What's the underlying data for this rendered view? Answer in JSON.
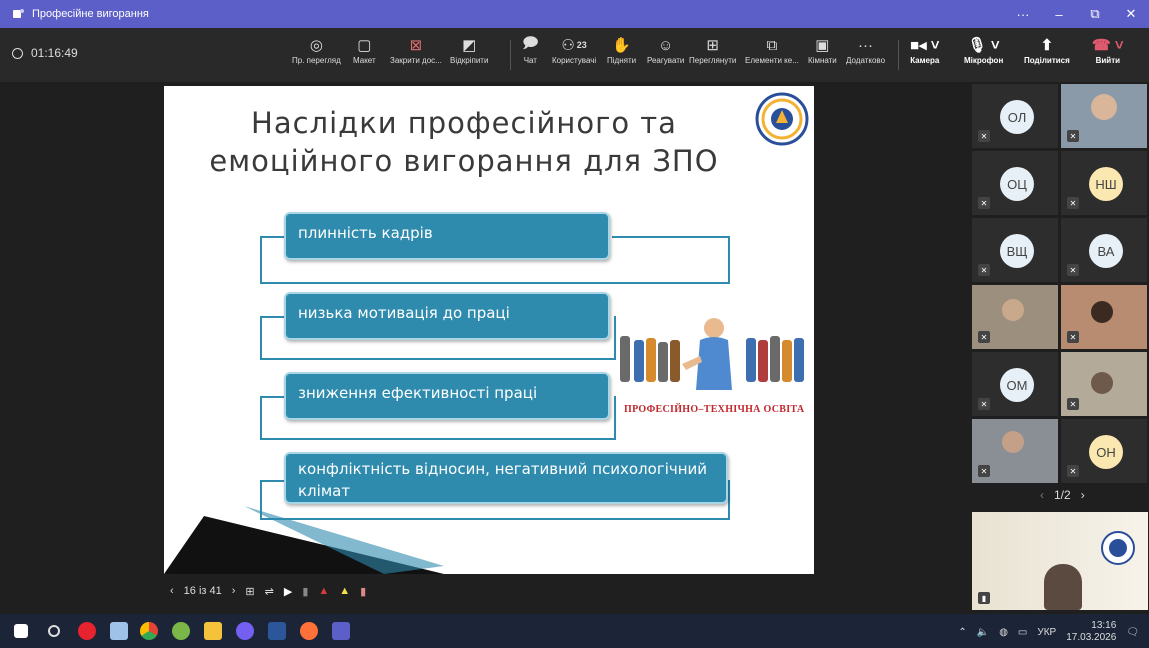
{
  "window": {
    "title": "Професійне вигорання",
    "more": "···",
    "minimize": "–",
    "restore": "⧉",
    "close": "✕"
  },
  "toolbar": {
    "timer": "01:16:49",
    "items": [
      {
        "label": "Пр. перегляд",
        "icon": "eye-icon"
      },
      {
        "label": "Макет",
        "icon": "layout-icon"
      },
      {
        "label": "Закрити дос...",
        "icon": "stop-share-icon"
      },
      {
        "label": "Відкріпити",
        "icon": "unpin-icon"
      },
      {
        "label": "Чат",
        "icon": "chat-icon"
      },
      {
        "label": "Користувачі",
        "icon": "people-icon",
        "count": "23"
      },
      {
        "label": "Підняти",
        "icon": "hand-icon"
      },
      {
        "label": "Реагувати",
        "icon": "smile-icon"
      },
      {
        "label": "Переглянути",
        "icon": "grid-icon"
      },
      {
        "label": "Елементи ке...",
        "icon": "apps-icon"
      },
      {
        "label": "Кімнати",
        "icon": "rooms-icon"
      },
      {
        "label": "Додатково",
        "icon": "more-icon"
      }
    ],
    "camera": "Камера",
    "mic": "Мікрофон",
    "share": "Поділитися",
    "leave": "Вийти"
  },
  "slide": {
    "title_line1": "Наслідки професійного та",
    "title_line2": "емоційного вигорання для ЗПО",
    "items": [
      "плинність кадрів",
      "низька мотивація до праці",
      "зниження ефективності праці",
      "конфліктність відносин, негативний психологічний клімат"
    ],
    "promo_caption": "ПРОФЕСІЙНО–ТЕХНІЧНА ОСВІТА"
  },
  "slide_controls": {
    "page": "16 із 41"
  },
  "participants": [
    {
      "initials": "ОЛ",
      "photo": false
    },
    {
      "initials": "",
      "photo": true
    },
    {
      "initials": "ОЦ",
      "photo": false
    },
    {
      "initials": "НШ",
      "photo": false,
      "yellow": true
    },
    {
      "initials": "ВЩ",
      "photo": false
    },
    {
      "initials": "ВА",
      "photo": false
    },
    {
      "initials": "",
      "photo": true
    },
    {
      "initials": "",
      "photo": true
    },
    {
      "initials": "ОМ",
      "photo": false
    },
    {
      "initials": "",
      "photo": true
    },
    {
      "initials": "",
      "photo": true
    },
    {
      "initials": "ОН",
      "photo": false,
      "yellow": true
    }
  ],
  "pager": {
    "text": "1/2"
  },
  "taskbar": {
    "language": "УКР",
    "time": "13:16",
    "date": "17.03.2026"
  },
  "colors": {
    "titlebar": "#5b5fc7",
    "accent": "#2e8bad",
    "leave": "#c4314b"
  }
}
